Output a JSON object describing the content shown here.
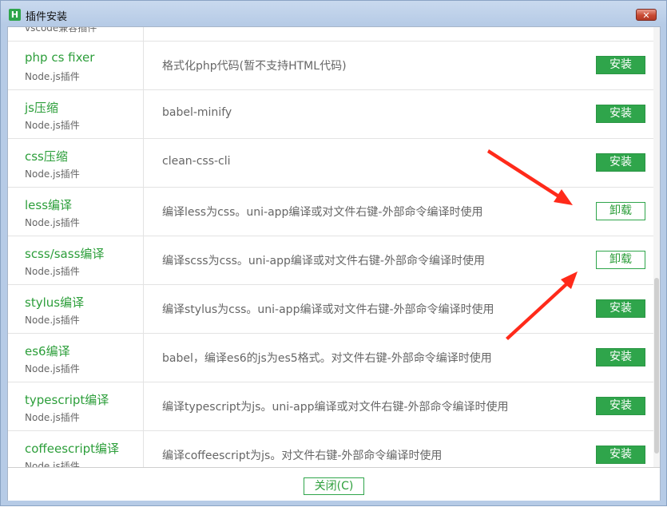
{
  "window": {
    "title": "插件安装",
    "icon_letter": "H",
    "close_glyph": "✕"
  },
  "plugins": [
    {
      "name": "",
      "type": "vscode兼容插件",
      "description": "",
      "action": ""
    },
    {
      "name": "php cs fixer",
      "type": "Node.js插件",
      "description": "格式化php代码(暂不支持HTML代码)",
      "action": "安装",
      "action_kind": "install"
    },
    {
      "name": "js压缩",
      "type": "Node.js插件",
      "description": "babel-minify",
      "action": "安装",
      "action_kind": "install"
    },
    {
      "name": "css压缩",
      "type": "Node.js插件",
      "description": "clean-css-cli",
      "action": "安装",
      "action_kind": "install"
    },
    {
      "name": "less编译",
      "type": "Node.js插件",
      "description": "编译less为css。uni-app编译或对文件右键-外部命令编译时使用",
      "action": "卸载",
      "action_kind": "uninstall"
    },
    {
      "name": "scss/sass编译",
      "type": "Node.js插件",
      "description": "编译scss为css。uni-app编译或对文件右键-外部命令编译时使用",
      "action": "卸载",
      "action_kind": "uninstall"
    },
    {
      "name": "stylus编译",
      "type": "Node.js插件",
      "description": "编译stylus为css。uni-app编译或对文件右键-外部命令编译时使用",
      "action": "安装",
      "action_kind": "install"
    },
    {
      "name": "es6编译",
      "type": "Node.js插件",
      "description": "babel，编译es6的js为es5格式。对文件右键-外部命令编译时使用",
      "action": "安装",
      "action_kind": "install"
    },
    {
      "name": "typescript编译",
      "type": "Node.js插件",
      "description": "编译typescript为js。uni-app编译或对文件右键-外部命令编译时使用",
      "action": "安装",
      "action_kind": "install"
    },
    {
      "name": "coffeescript编译",
      "type": "Node.js插件",
      "description": "编译coffeescript为js。对文件右键-外部命令编译时使用",
      "action": "安装",
      "action_kind": "install"
    }
  ],
  "footer": {
    "close_label": "关闭(C)"
  },
  "colors": {
    "accent": "#2fa54b",
    "arrow": "#ff2a1a"
  }
}
